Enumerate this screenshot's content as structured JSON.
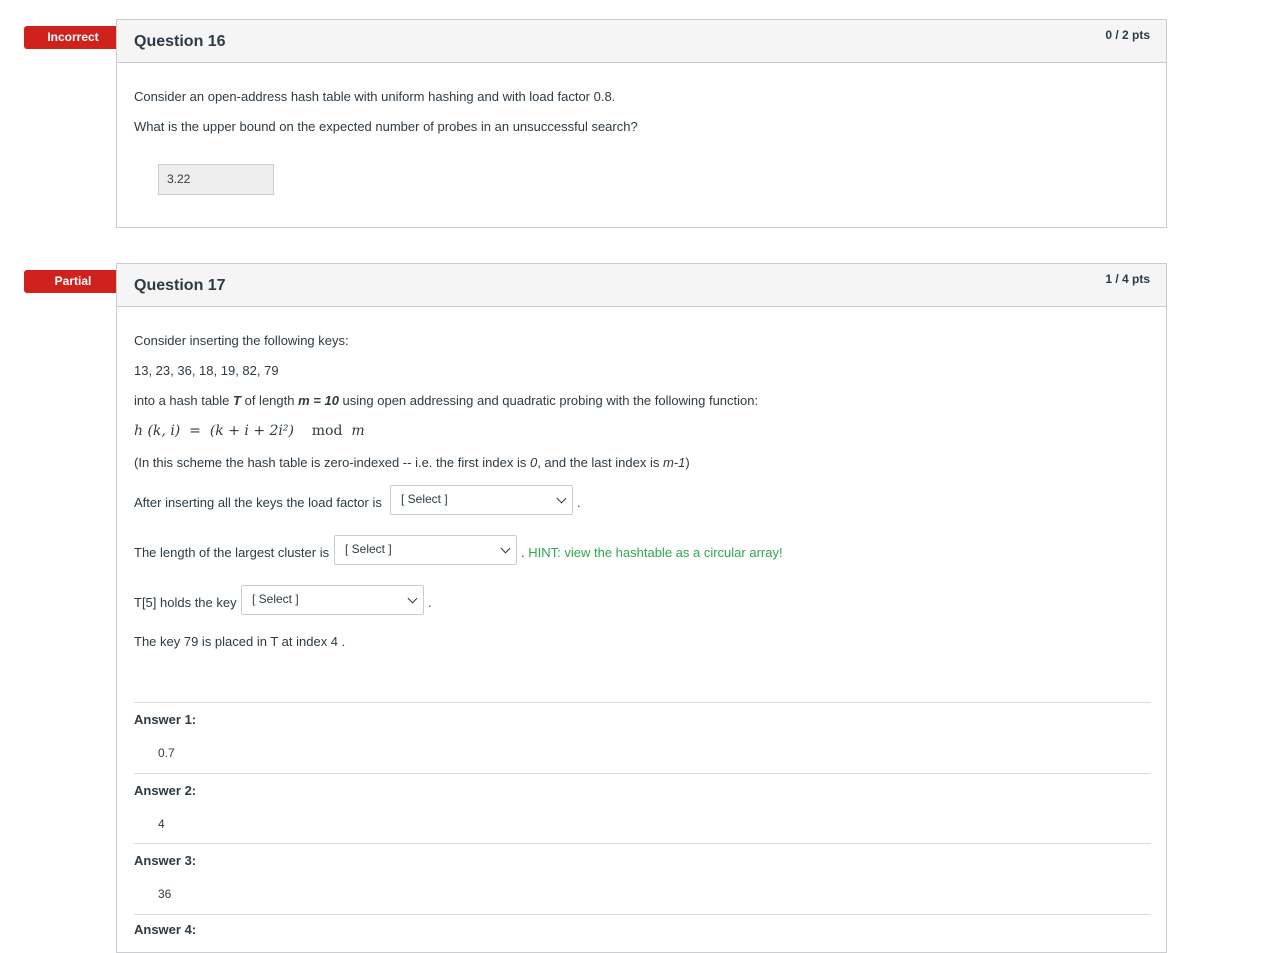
{
  "q16": {
    "flag": "Incorrect",
    "title": "Question 16",
    "points": "0 / 2 pts",
    "line1": "Consider an open-address hash table with uniform hashing and with load factor 0.8.",
    "line2": "What is the upper bound on the expected number of probes in an unsuccessful search?",
    "answer": "3.22"
  },
  "q17": {
    "flag": "Partial",
    "title": "Question 17",
    "points": "1 / 4 pts",
    "intro": "Consider inserting the following keys:",
    "keys": "13, 23, 36, 18, 19, 82, 79",
    "table_pre": "into a hash table ",
    "table_T": "T",
    "table_mid": " of length ",
    "table_m": "m = 10",
    "table_post": " using open addressing and quadratic probing with the following function:",
    "formula": {
      "lhs": "h (k, i)",
      "eq": "=",
      "rhs": "(k + i + 2i²)",
      "mod": "mod",
      "m": "m"
    },
    "scheme_pre": "(In this scheme the hash table is zero-indexed -- i.e. the first index is ",
    "scheme_zero": "0",
    "scheme_mid": ", and the last index is ",
    "scheme_last": "m-1",
    "scheme_post": ")",
    "load_text": "After inserting all the keys the load factor is",
    "load_select": "[ Select ]",
    "cluster_text": "The length of the largest cluster is",
    "cluster_select": "[ Select ]",
    "hint": "HINT: view the hashtable as a circular array!",
    "t5_text": "T[5] holds the key",
    "t5_select": "[ Select ]",
    "period": ".",
    "key79": "The key 79 is placed in T at index 4 .",
    "answers": [
      {
        "label": "Answer 1:",
        "value": "0.7"
      },
      {
        "label": "Answer 2:",
        "value": "4"
      },
      {
        "label": "Answer 3:",
        "value": "36"
      },
      {
        "label": "Answer 4:",
        "value": ""
      }
    ]
  }
}
